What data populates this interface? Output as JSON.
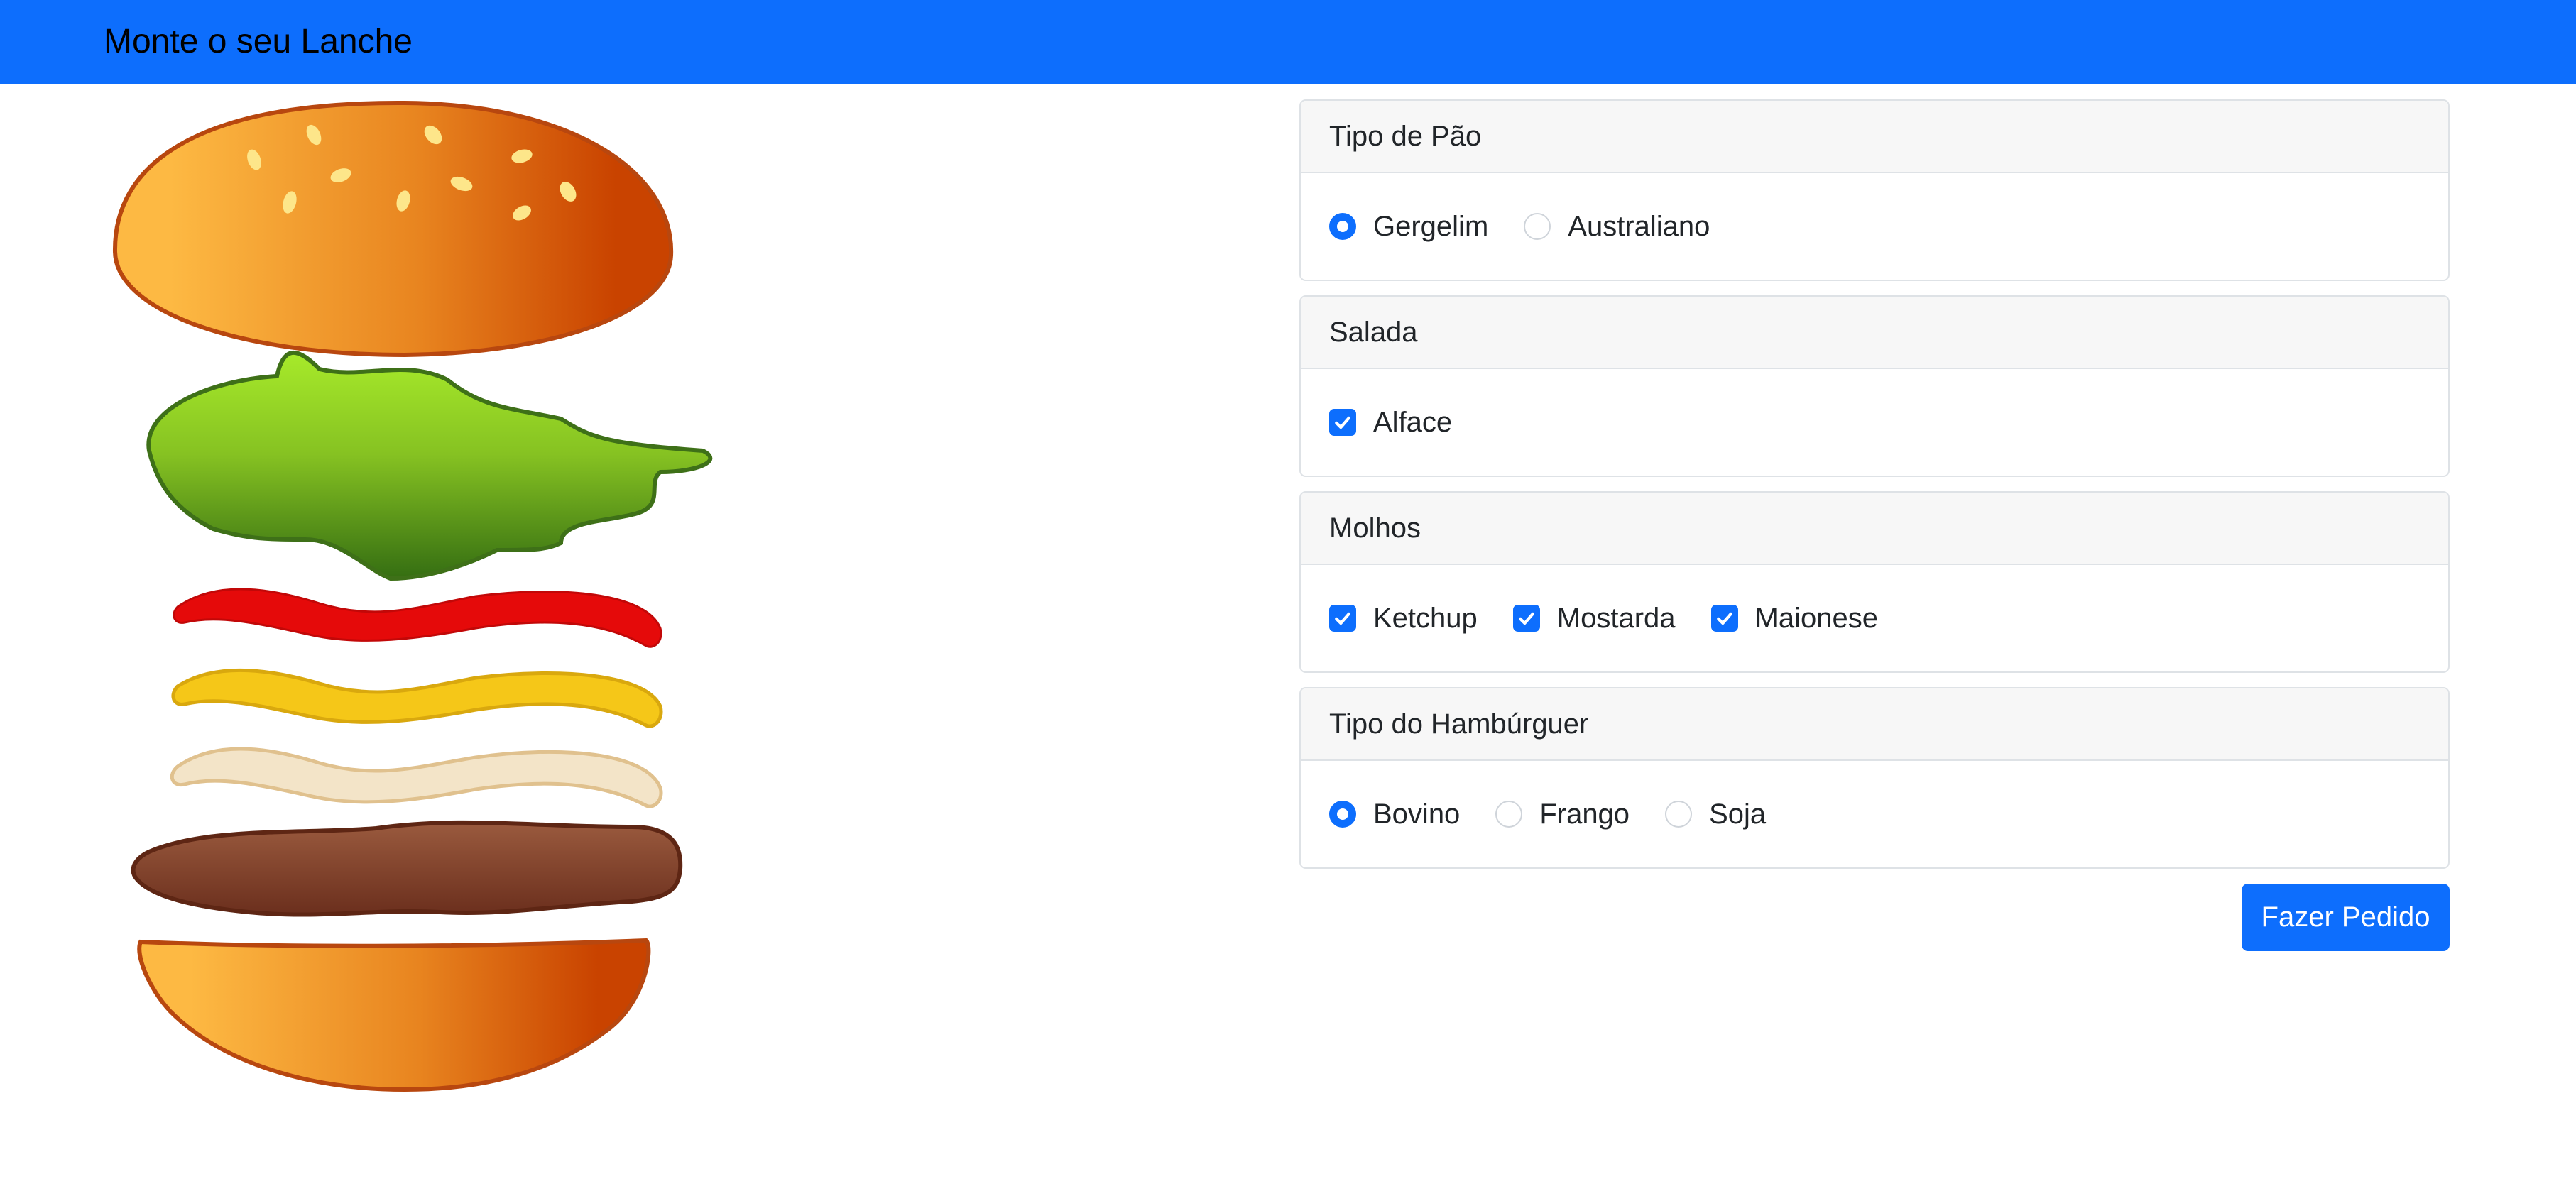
{
  "header": {
    "title": "Monte o seu Lanche"
  },
  "sections": [
    {
      "title": "Tipo de Pão",
      "input_type": "radio",
      "options": [
        {
          "label": "Gergelim",
          "selected": true
        },
        {
          "label": "Australiano",
          "selected": false
        }
      ]
    },
    {
      "title": "Salada",
      "input_type": "checkbox",
      "options": [
        {
          "label": "Alface",
          "selected": true
        }
      ]
    },
    {
      "title": "Molhos",
      "input_type": "checkbox",
      "options": [
        {
          "label": "Ketchup",
          "selected": true
        },
        {
          "label": "Mostarda",
          "selected": true
        },
        {
          "label": "Maionese",
          "selected": true
        }
      ]
    },
    {
      "title": "Tipo do Hambúrguer",
      "input_type": "radio",
      "options": [
        {
          "label": "Bovino",
          "selected": true
        },
        {
          "label": "Frango",
          "selected": false
        },
        {
          "label": "Soja",
          "selected": false
        }
      ]
    }
  ],
  "order_button": {
    "label": "Fazer Pedido"
  },
  "burger_illustration": {
    "layers": [
      "sesame-bun-top",
      "lettuce",
      "ketchup",
      "mustard",
      "mayonnaise",
      "beef-patty",
      "bun-bottom"
    ]
  },
  "colors": {
    "accent": "#0d6efd",
    "panel_header_bg": "#f7f7f7",
    "border": "#dee2e6"
  }
}
